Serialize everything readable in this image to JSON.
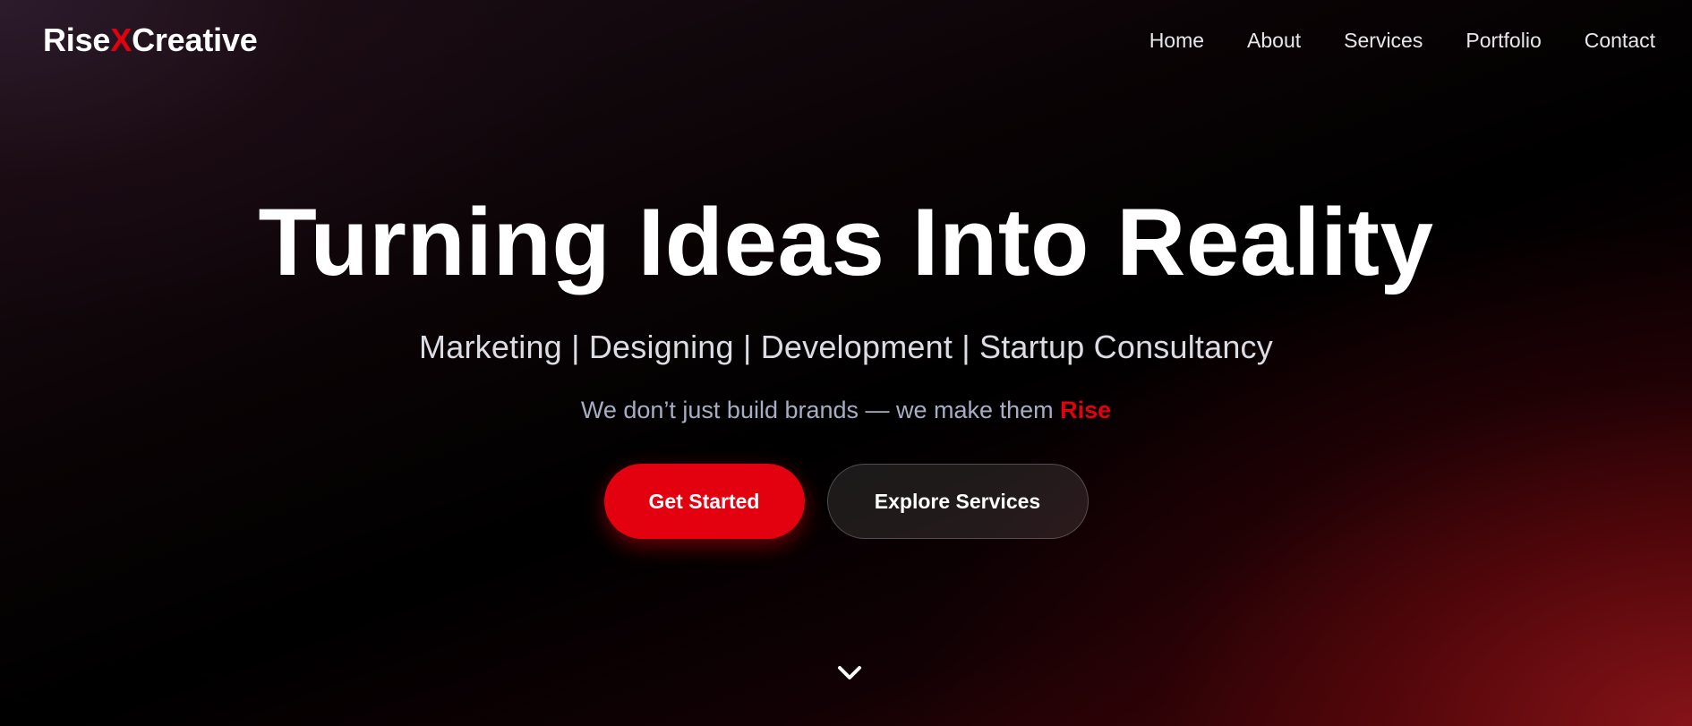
{
  "header": {
    "logo": {
      "part1": "Rise",
      "part2": "X",
      "part3": "Creative"
    },
    "nav": [
      "Home",
      "About",
      "Services",
      "Portfolio",
      "Contact"
    ]
  },
  "hero": {
    "title": "Turning Ideas Into Reality",
    "subtitle": "Marketing | Designing | Development | Startup Consultancy",
    "tagline": "We don’t just build brands — we make them ",
    "tagline_highlight": "Rise",
    "primary_button": "Get Started",
    "secondary_button": "Explore Services"
  },
  "icons": {
    "scroll": "chevron-down-icon"
  },
  "colors": {
    "accent": "#e3000f",
    "background": "#000000",
    "text": "#ffffff"
  }
}
